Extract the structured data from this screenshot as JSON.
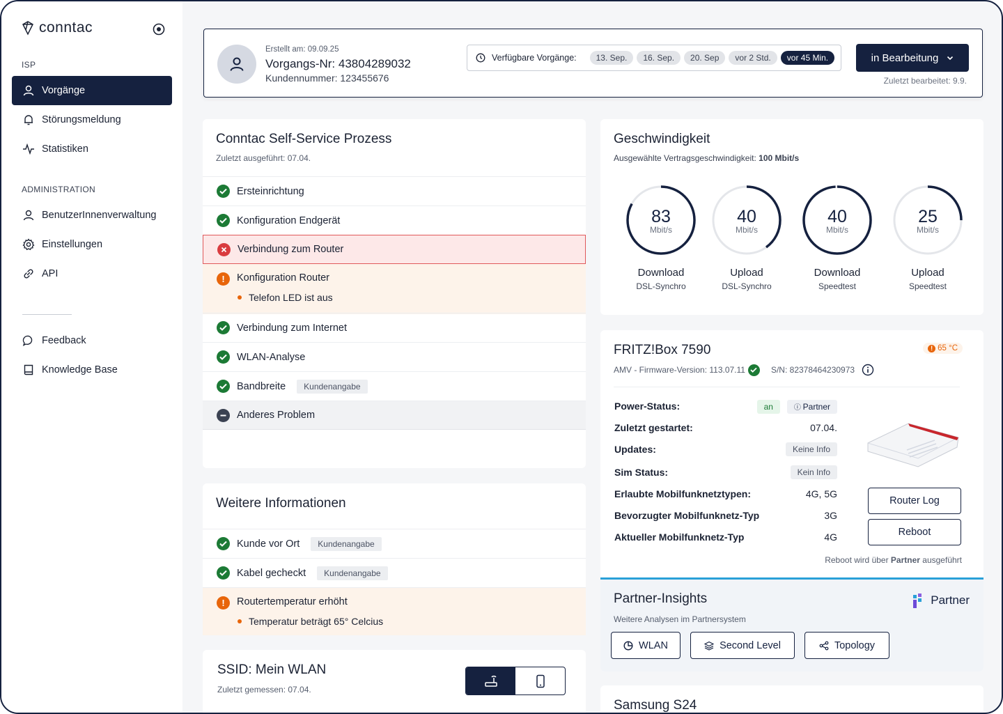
{
  "sidebar": {
    "logo": "conntac",
    "section_isp": "ISP",
    "section_admin": "ADMINISTRATION",
    "items": [
      {
        "label": "Vorgänge"
      },
      {
        "label": "Störungsmeldung"
      },
      {
        "label": "Statistiken"
      },
      {
        "label": "BenutzerInnenverwaltung"
      },
      {
        "label": "Einstellungen"
      },
      {
        "label": "API"
      },
      {
        "label": "Feedback"
      },
      {
        "label": "Knowledge Base"
      }
    ]
  },
  "header": {
    "created": "Erstellt am: 09.09.25",
    "case_number": "Vorgangs-Nr: 43804289032",
    "customer_number": "Kundennummer: 123455676",
    "available_label": "Verfügbare Vorgänge:",
    "chips": [
      "13. Sep.",
      "16. Sep.",
      "20. Sep",
      "vor 2 Std.",
      "vor 45 Min."
    ],
    "status_button": "in Bearbeitung",
    "last_edited": "Zuletzt bearbeitet: 9.9."
  },
  "process": {
    "title": "Conntac Self-Service Prozess",
    "subtitle": "Zuletzt ausgeführt: 07.04.",
    "steps": [
      {
        "label": "Ersteinrichtung",
        "status": "ok"
      },
      {
        "label": "Konfiguration Endgerät",
        "status": "ok"
      },
      {
        "label": "Verbindung zum Router",
        "status": "error"
      },
      {
        "label": "Konfiguration Router",
        "status": "warning",
        "detail": "Telefon LED ist aus"
      },
      {
        "label": "Verbindung zum Internet",
        "status": "ok"
      },
      {
        "label": "WLAN-Analyse",
        "status": "ok"
      },
      {
        "label": "Bandbreite",
        "status": "ok",
        "tag": "Kundenangabe"
      },
      {
        "label": "Anderes Problem",
        "status": "neutral"
      }
    ]
  },
  "speed": {
    "title": "Geschwindigkeit",
    "contract_label": "Ausgewählte Vertragsgeschwindigkeit:",
    "contract_value": "100 Mbit/s",
    "gauges": [
      {
        "value": "83",
        "unit": "Mbit/s",
        "label": "Download",
        "source": "DSL-Synchro",
        "fraction": 0.83
      },
      {
        "value": "40",
        "unit": "Mbit/s",
        "label": "Upload",
        "source": "DSL-Synchro",
        "fraction": 0.4
      },
      {
        "value": "40",
        "unit": "Mbit/s",
        "label": "Download",
        "source": "Speedtest",
        "fraction": 0.99
      },
      {
        "value": "25",
        "unit": "Mbit/s",
        "label": "Upload",
        "source": "Speedtest",
        "fraction": 0.25
      }
    ]
  },
  "weitere": {
    "title": "Weitere Informationen",
    "items": [
      {
        "label": "Kunde vor Ort",
        "status": "ok",
        "tag": "Kundenangabe"
      },
      {
        "label": "Kabel gecheckt",
        "status": "ok",
        "tag": "Kundenangabe"
      },
      {
        "label": "Routertemperatur erhöht",
        "status": "warning",
        "detail": "Temperatur beträgt 65° Celcius"
      }
    ]
  },
  "fritz": {
    "title": "FRITZ!Box 7590",
    "temperature": "65 °C",
    "firmware": "AMV - Firmware-Version: 113.07.11",
    "serial": "S/N: 82378464230973",
    "power_label": "Power-Status:",
    "power_value": "an",
    "partner_badge": "Partner",
    "rows": [
      {
        "key": "Zuletzt gestartet:",
        "value": "07.04."
      },
      {
        "key": "Updates:",
        "value": "Keine Info"
      },
      {
        "key": "Sim Status:",
        "value": "Kein Info"
      },
      {
        "key": "Erlaubte Mobilfunknetztypen:",
        "value": "4G, 5G"
      },
      {
        "key": "Bevorzugter Mobilfunknetz-Typ",
        "value": "3G"
      },
      {
        "key": "Aktueller Mobilfunknetz-Typ",
        "value": "4G"
      }
    ],
    "router_log": "Router Log",
    "reboot": "Reboot",
    "reboot_note_pre": "Reboot wird über ",
    "reboot_note_bold": "Partner",
    "reboot_note_post": " ausgeführt"
  },
  "partner": {
    "title": "Partner-Insights",
    "subtitle": "Weitere Analysen im Partnersystem",
    "brand": "Partner",
    "buttons": [
      "WLAN",
      "Second Level",
      "Topology"
    ]
  },
  "wlan": {
    "title": "SSID: Mein WLAN",
    "subtitle": "Zuletzt gemessen: 07.04."
  },
  "samsung": {
    "title": "Samsung S24"
  }
}
